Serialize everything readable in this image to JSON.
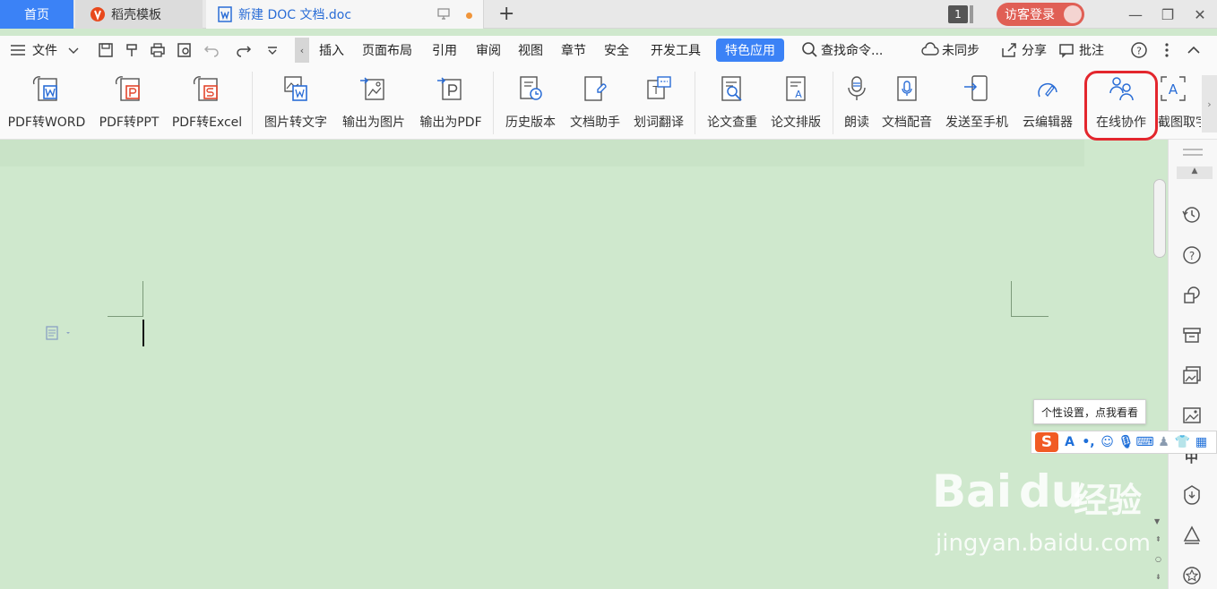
{
  "titlebar": {
    "tabs": [
      {
        "label": "首页"
      },
      {
        "label": "稻壳模板"
      },
      {
        "label": "新建 DOC 文档.doc"
      }
    ],
    "new_tab": "+",
    "window_count": "1",
    "login_label": "访客登录"
  },
  "menubar": {
    "file_label": "文件",
    "items": [
      "插入",
      "页面布局",
      "引用",
      "审阅",
      "视图",
      "章节",
      "安全",
      "开发工具"
    ],
    "active_item": "特色应用",
    "search_label": "查找命令...",
    "sync_label": "未同步",
    "share_label": "分享",
    "comment_label": "批注"
  },
  "ribbon": {
    "buttons": [
      {
        "label": "PDF转WORD",
        "icon": "pdf-to-word-icon"
      },
      {
        "label": "PDF转PPT",
        "icon": "pdf-to-ppt-icon"
      },
      {
        "label": "PDF转Excel",
        "icon": "pdf-to-excel-icon"
      },
      {
        "label": "图片转文字",
        "icon": "image-to-text-icon"
      },
      {
        "label": "输出为图片",
        "icon": "export-image-icon"
      },
      {
        "label": "输出为PDF",
        "icon": "export-pdf-icon"
      },
      {
        "label": "历史版本",
        "icon": "history-version-icon"
      },
      {
        "label": "文档助手",
        "icon": "doc-assistant-icon"
      },
      {
        "label": "划词翻译",
        "icon": "translate-icon"
      },
      {
        "label": "论文查重",
        "icon": "plagiarism-check-icon"
      },
      {
        "label": "论文排版",
        "icon": "paper-layout-icon"
      },
      {
        "label": "朗读",
        "icon": "read-aloud-icon"
      },
      {
        "label": "文档配音",
        "icon": "doc-voice-icon"
      },
      {
        "label": "发送至手机",
        "icon": "send-to-phone-icon"
      },
      {
        "label": "云编辑器",
        "icon": "cloud-editor-icon"
      },
      {
        "label": "在线协作",
        "icon": "online-collab-icon"
      },
      {
        "label": "截图取字",
        "icon": "screenshot-text-icon"
      }
    ]
  },
  "ime": {
    "tooltip": "个性设置，点我看看"
  },
  "watermark": {
    "brand": "Bai",
    "brand2": "du",
    "cn": "经验",
    "url": "jingyan.baidu.com"
  },
  "colors": {
    "accent": "#3b82f6",
    "doc_bg": "#cfe8cd",
    "highlight": "#e3262d",
    "login": "#e05f55"
  }
}
